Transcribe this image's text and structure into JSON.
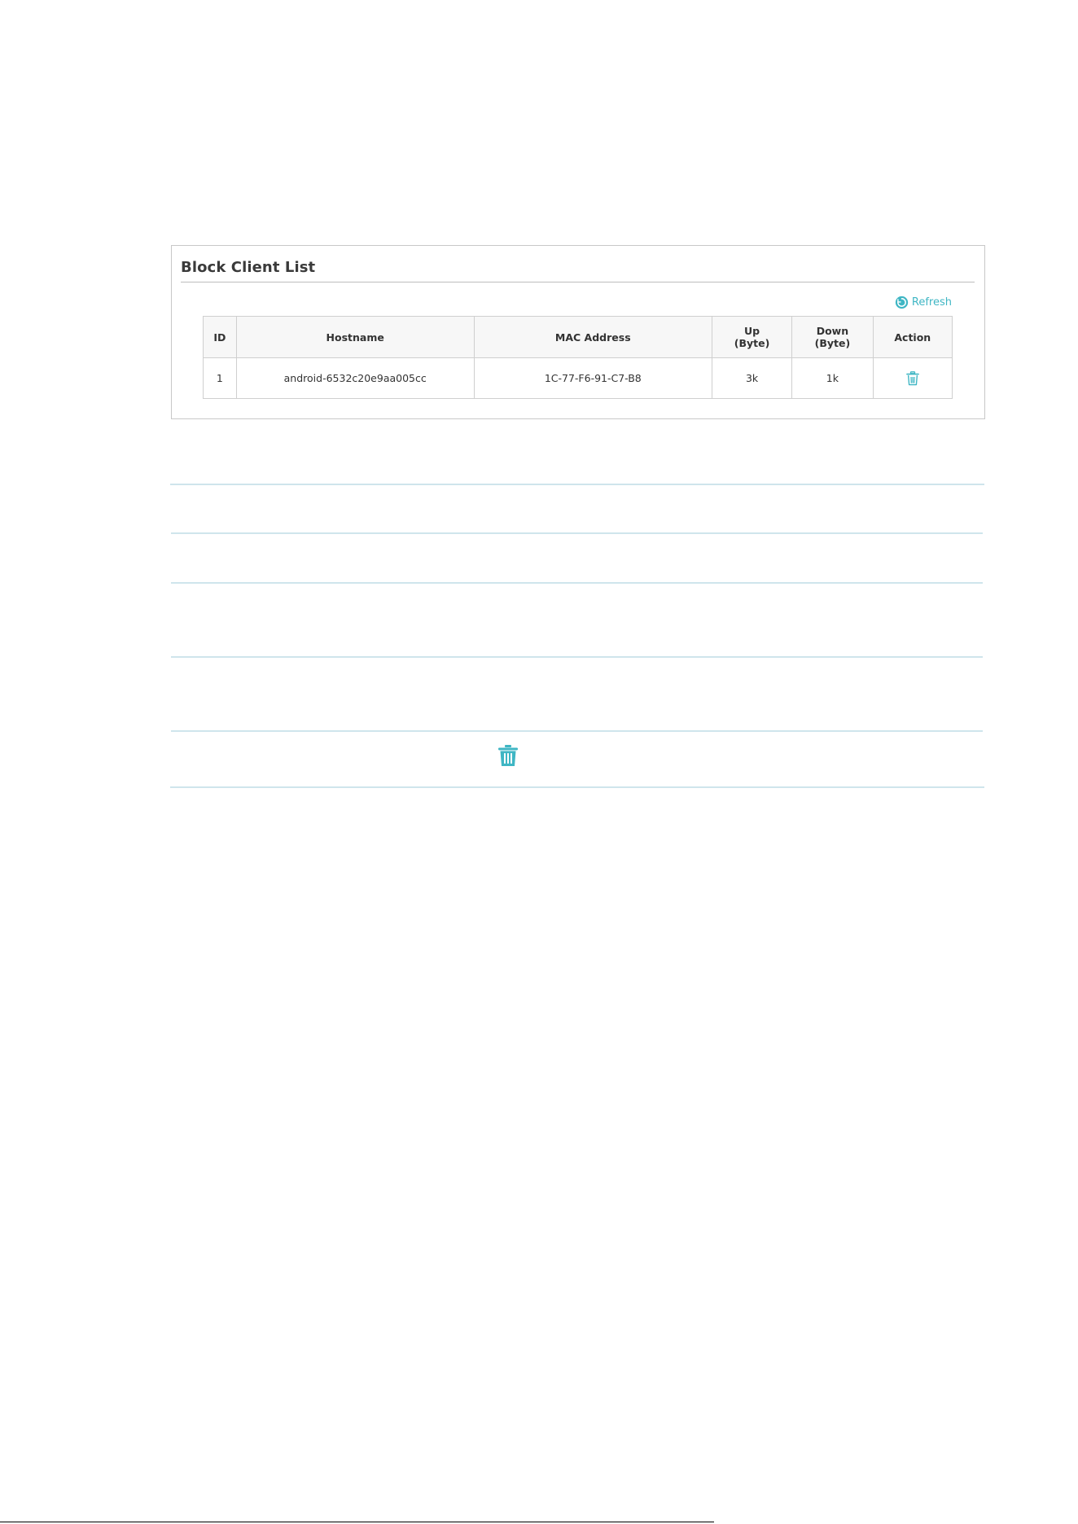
{
  "panel": {
    "title": "Block Client List",
    "refresh_label": "Refresh"
  },
  "table": {
    "headers": {
      "id": "ID",
      "hostname": "Hostname",
      "mac": "MAC Address",
      "up_line1": "Up",
      "up_line2": "(Byte)",
      "down_line1": "Down",
      "down_line2": "(Byte)",
      "action": "Action"
    },
    "rows": [
      {
        "id": "1",
        "hostname": "android-6532c20e9aa005cc",
        "mac": "1C-77-F6-91-C7-B8",
        "up": "3k",
        "down": "1k"
      }
    ]
  },
  "icons": {
    "refresh": "refresh-icon",
    "delete": "trash-icon"
  },
  "colors": {
    "accent": "#3fb6c4",
    "rule": "#cfe5ec",
    "border": "#c8c8c8",
    "header_bg": "#f7f7f7"
  }
}
